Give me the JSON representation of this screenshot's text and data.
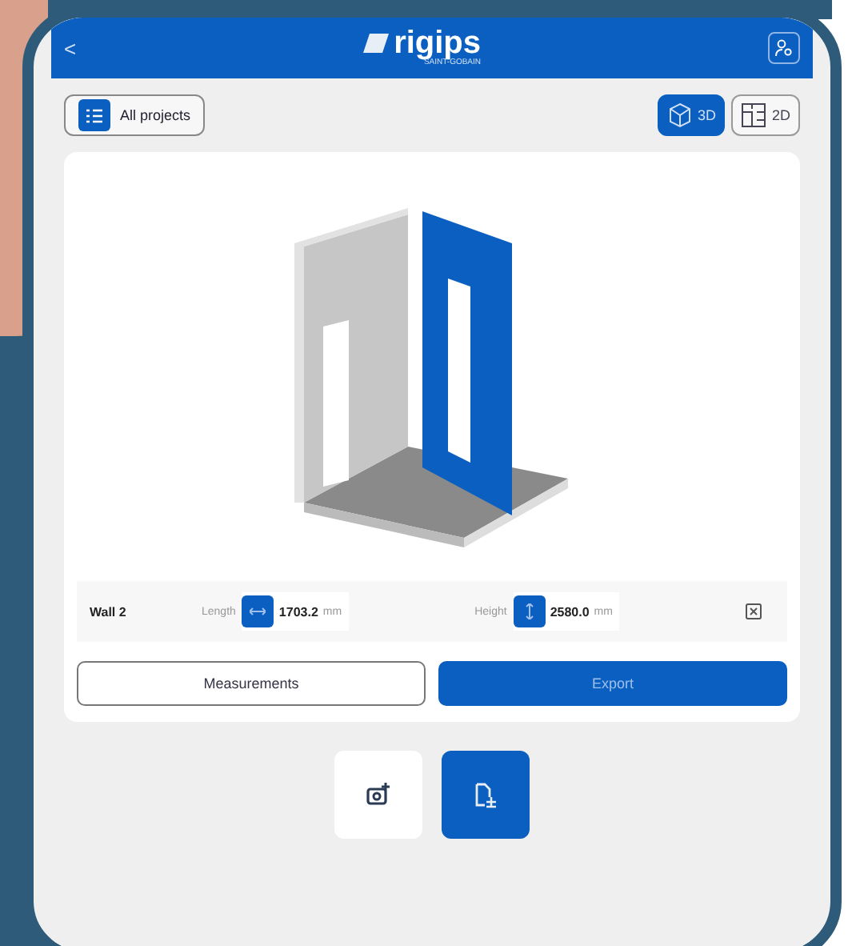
{
  "app_bar": {
    "back": "<",
    "logo": "rigips",
    "logo_subtitle": "SAINT-GOBAIN"
  },
  "toolbar": {
    "projects_button": "All projects",
    "view_tabs": [
      {
        "label": "3D",
        "selected": true
      },
      {
        "label": "2D",
        "selected": false
      }
    ]
  },
  "wall": {
    "name": "Wall 2",
    "length_label": "Length",
    "length_value": "1703.2",
    "length_unit": "mm",
    "height_label": "Height",
    "height_value": "2580.0",
    "height_unit": "mm"
  },
  "actions": [
    {
      "label": "Measurements",
      "kind": "outline"
    },
    {
      "label": "Export",
      "kind": "primary"
    }
  ],
  "bottom_buttons": [
    {
      "kind": "camera",
      "selected": false
    },
    {
      "kind": "file",
      "selected": true
    }
  ]
}
